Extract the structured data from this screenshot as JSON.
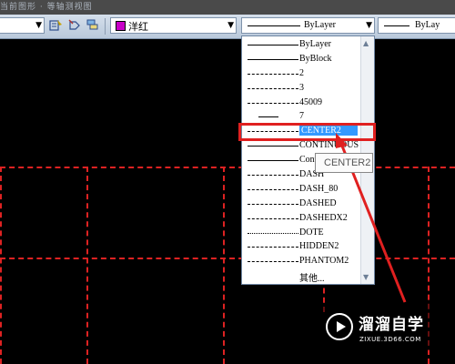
{
  "topbar": {
    "faded_text": "当前图形 · 等轴测视图"
  },
  "toolbar": {
    "color_value": "洋红",
    "color_swatch": "#c800c8",
    "linetype_value": "ByLayer",
    "lineweight_value": "ByLay",
    "icons": [
      "match-properties-icon",
      "layer-previous-icon",
      "layer-state-icon"
    ]
  },
  "dropdown": {
    "items": [
      {
        "name": "ByLayer",
        "pattern": "solid"
      },
      {
        "name": "ByBlock",
        "pattern": "solid"
      },
      {
        "name": "2",
        "pattern": "dashdot"
      },
      {
        "name": "3",
        "pattern": "dash"
      },
      {
        "name": "45009",
        "pattern": "dashed"
      },
      {
        "name": "7",
        "pattern": "short"
      },
      {
        "name": "CENTER2",
        "pattern": "center",
        "selected": true
      },
      {
        "name": "CONTINUOUS",
        "pattern": "solid"
      },
      {
        "name": "Cont",
        "pattern": "solid"
      },
      {
        "name": "DASH",
        "pattern": "dash"
      },
      {
        "name": "DASH_80",
        "pattern": "dashed"
      },
      {
        "name": "DASHED",
        "pattern": "dash"
      },
      {
        "name": "DASHEDX2",
        "pattern": "dash"
      },
      {
        "name": "DOTE",
        "pattern": "dotted"
      },
      {
        "name": "HIDDEN2",
        "pattern": "dash"
      },
      {
        "name": "PHANTOM2",
        "pattern": "dashdot"
      },
      {
        "name": "其他...",
        "pattern": "none"
      }
    ]
  },
  "tooltip": "CENTER2",
  "watermark": {
    "title": "溜溜自学",
    "url": "ZIXUE.3D66.COM"
  },
  "colors": {
    "highlight": "#e02020",
    "drawing_lines": "#d22222",
    "selection": "#3399ff"
  }
}
